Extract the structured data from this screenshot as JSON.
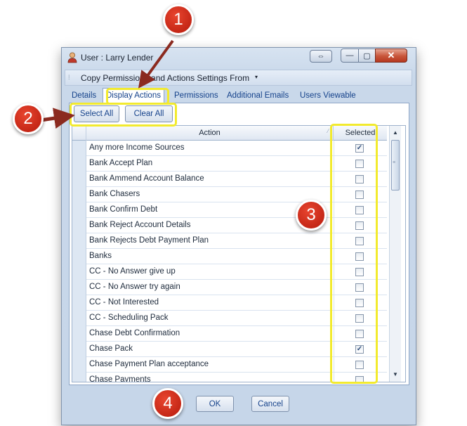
{
  "window": {
    "title": "User : Larry Lender",
    "close_glyph": "✕",
    "minimize_glyph": "—",
    "maximize_glyph": "▢",
    "restore_glyph": "⇔"
  },
  "menu": {
    "copy_label": "Copy Permissions and Actions Settings From",
    "caret": "▾"
  },
  "tabs": [
    "Details",
    "Display Actions",
    "Permissions",
    "Additional Emails",
    "Users Viewable"
  ],
  "active_tab": "Display Actions",
  "buttons": {
    "select_all": "Select All",
    "clear_all": "Clear All",
    "ok": "OK",
    "cancel": "Cancel"
  },
  "grid": {
    "col_action": "Action",
    "col_selected": "Selected",
    "rows": [
      {
        "action": "Any more Income Sources",
        "selected": true
      },
      {
        "action": "Bank Accept Plan",
        "selected": false
      },
      {
        "action": "Bank Ammend Account Balance",
        "selected": false
      },
      {
        "action": "Bank Chasers",
        "selected": false
      },
      {
        "action": "Bank Confirm Debt",
        "selected": false
      },
      {
        "action": "Bank Reject Account Details",
        "selected": false
      },
      {
        "action": "Bank Rejects Debt Payment Plan",
        "selected": false
      },
      {
        "action": "Banks",
        "selected": false
      },
      {
        "action": "CC - No Answer give up",
        "selected": false
      },
      {
        "action": "CC - No Answer try again",
        "selected": false
      },
      {
        "action": "CC - Not Interested",
        "selected": false
      },
      {
        "action": "CC - Scheduling Pack",
        "selected": false
      },
      {
        "action": "Chase Debt Confirmation",
        "selected": false
      },
      {
        "action": "Chase Pack",
        "selected": true
      },
      {
        "action": "Chase Payment Plan acceptance",
        "selected": false
      },
      {
        "action": "Chase Payments",
        "selected": false
      }
    ]
  },
  "callouts": [
    "1",
    "2",
    "3",
    "4"
  ],
  "colors": {
    "callout_red": "#c8220f",
    "highlight_yellow": "#f2ea2e",
    "tab_text": "#15428b"
  }
}
